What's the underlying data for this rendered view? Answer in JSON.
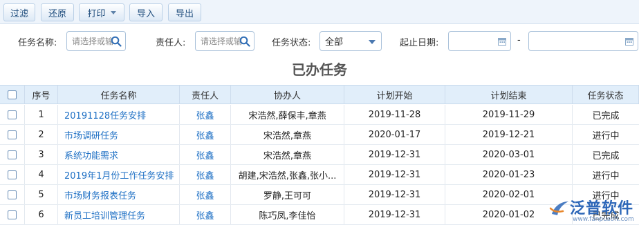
{
  "toolbar": {
    "filter": "过滤",
    "reset": "还原",
    "print": "打印",
    "import": "导入",
    "export": "导出"
  },
  "filters": {
    "task_name_label": "任务名称:",
    "task_name_placeholder": "请选择或输",
    "owner_label": "责任人:",
    "owner_placeholder": "请选择或输",
    "status_label": "任务状态:",
    "status_value": "全部",
    "date_label": "起止日期:",
    "date_separator": "-"
  },
  "page_title": "已办任务",
  "table": {
    "headers": [
      "序号",
      "任务名称",
      "责任人",
      "协办人",
      "计划开始",
      "计划结束",
      "任务状态"
    ],
    "rows": [
      {
        "no": "1",
        "name": "20191128任务安排",
        "owner": "张鑫",
        "assist": "宋浩然,薛保丰,章燕",
        "start": "2019-11-28",
        "end": "2019-11-29",
        "status": "已完成"
      },
      {
        "no": "2",
        "name": "市场调研任务",
        "owner": "张鑫",
        "assist": "宋浩然,章燕",
        "start": "2020-01-17",
        "end": "2019-12-21",
        "status": "进行中"
      },
      {
        "no": "3",
        "name": "系统功能需求",
        "owner": "张鑫",
        "assist": "宋浩然,章燕",
        "start": "2019-12-31",
        "end": "2020-03-01",
        "status": "已完成"
      },
      {
        "no": "4",
        "name": "2019年1月份工作任务安排",
        "owner": "张鑫",
        "assist": "胡建,宋浩然,张鑫,张小...",
        "start": "2019-12-31",
        "end": "2020-01-23",
        "status": "进行中"
      },
      {
        "no": "5",
        "name": "市场财务报表任务",
        "owner": "张鑫",
        "assist": "罗静,王可可",
        "start": "2019-12-31",
        "end": "2020-02-01",
        "status": "进行中"
      },
      {
        "no": "6",
        "name": "新员工培训管理任务",
        "owner": "张鑫",
        "assist": "陈巧凤,李佳怡",
        "start": "2019-12-31",
        "end": "2020-01-02",
        "status": "已完成"
      }
    ]
  },
  "watermark": {
    "name": "泛普软件",
    "url": "www.fanpusoft.com"
  }
}
